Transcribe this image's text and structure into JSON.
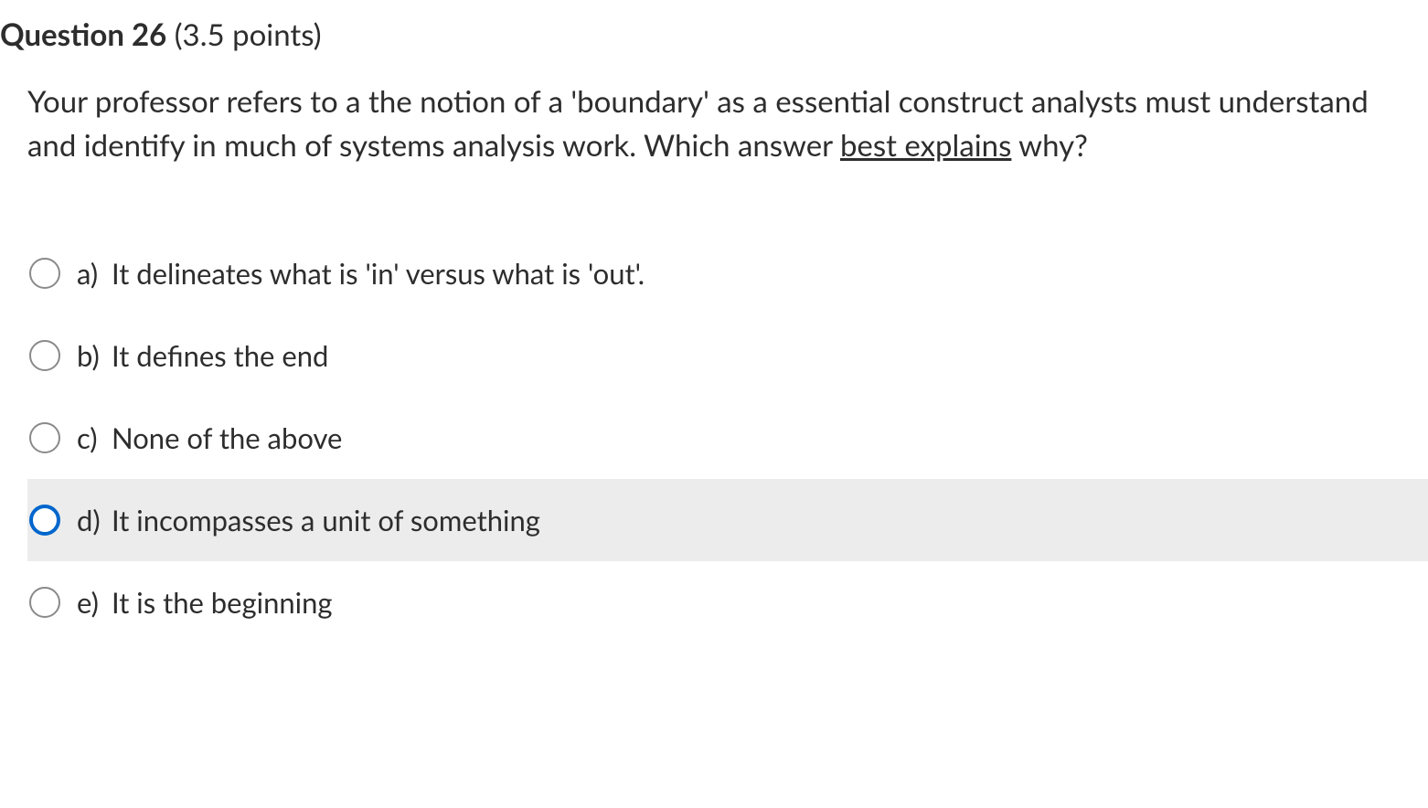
{
  "question": {
    "number_label": "Question 26",
    "points_label": "(3.5 points)",
    "text_part1": "Your professor refers to a the notion of a 'boundary' as a essential construct analysts must understand and identify in much of systems analysis work. Which answer ",
    "underlined_part": "best explains",
    "text_part2": " why?"
  },
  "options": [
    {
      "letter": "a)",
      "text": "It delineates what is 'in' versus what is 'out'.",
      "hovered": false
    },
    {
      "letter": "b)",
      "text": "It defines the end",
      "hovered": false
    },
    {
      "letter": "c)",
      "text": "None of the above",
      "hovered": false
    },
    {
      "letter": "d)",
      "text": "It incompasses a unit of something",
      "hovered": true
    },
    {
      "letter": "e)",
      "text": "It is the beginning",
      "hovered": false
    }
  ]
}
